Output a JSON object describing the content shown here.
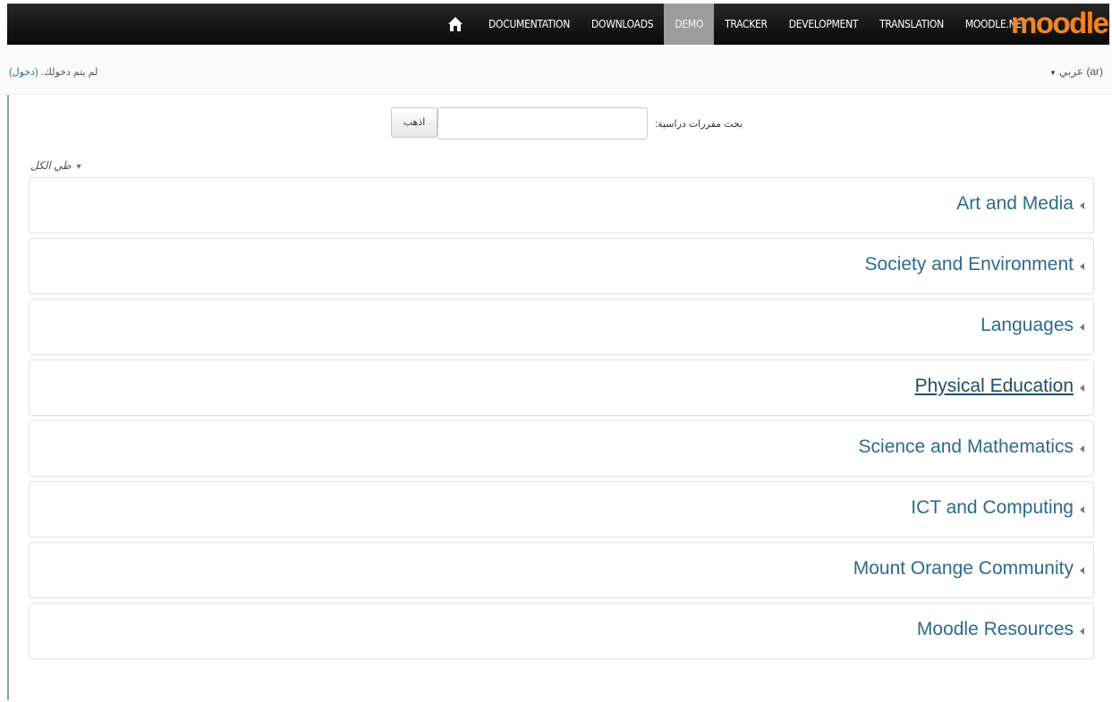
{
  "navbar": {
    "home_icon": "home-icon",
    "items": [
      {
        "label": "DOCUMENTATION"
      },
      {
        "label": "DOWNLOADS"
      },
      {
        "label": "DEMO",
        "active": true
      },
      {
        "label": "TRACKER"
      },
      {
        "label": "DEVELOPMENT"
      },
      {
        "label": "TRANSLATION"
      },
      {
        "label": "MOODLE.NET"
      }
    ],
    "logo": {
      "part1": "moo",
      "part2": "dle"
    }
  },
  "subbar": {
    "login_text": "لم يتم دخولك.",
    "login_link": "(دخول)",
    "language": "عربي ‎(ar)‎"
  },
  "search": {
    "label": "بحث مقررات دراسية:",
    "input_value": "",
    "button_label": "اذهب"
  },
  "collapse_all": "طي الكل",
  "categories": [
    {
      "name": "Art and Media"
    },
    {
      "name": "Society and Environment"
    },
    {
      "name": "Languages"
    },
    {
      "name": "Physical Education"
    },
    {
      "name": "Science and Mathematics"
    },
    {
      "name": "ICT and Computing"
    },
    {
      "name": "Mount Orange Community"
    },
    {
      "name": "Moodle Resources"
    }
  ],
  "colors": {
    "link": "#2e6a8e",
    "logo_orange": "#f0862a",
    "navbar_bg": "#1a1a1a",
    "active_tab": "#9c9c9c"
  }
}
